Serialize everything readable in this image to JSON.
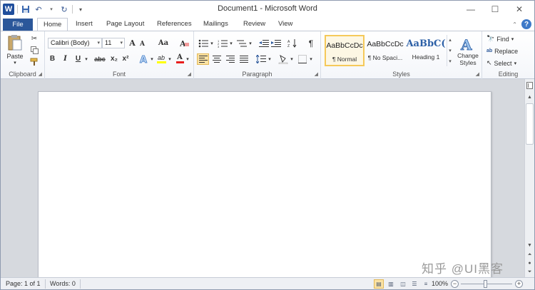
{
  "title_bar": {
    "document_title": "Document1 - Microsoft Word",
    "app_icon": "W",
    "quick_access": [
      "save-icon",
      "undo-icon",
      "redo-icon",
      "customize-icon"
    ],
    "window_controls": {
      "minimize": "—",
      "restore": "☐",
      "close": "✕"
    }
  },
  "tabs": {
    "file": "File",
    "items": [
      "Home",
      "Insert",
      "Page Layout",
      "References",
      "Mailings",
      "Review",
      "View"
    ],
    "active": "Home",
    "help": "?"
  },
  "ribbon": {
    "clipboard": {
      "label": "Clipboard",
      "paste": "Paste"
    },
    "font": {
      "label": "Font",
      "font_name": "Calibri (Body)",
      "font_size": "11",
      "bold": "B",
      "italic": "I",
      "underline": "U",
      "strike": "abc",
      "subscript": "x₂",
      "superscript": "x²",
      "grow": "A",
      "shrink": "A",
      "case": "Aa",
      "clear": "A",
      "highlight": "ab",
      "font_color": "A"
    },
    "paragraph": {
      "label": "Paragraph",
      "pilcrow": "¶"
    },
    "styles": {
      "label": "Styles",
      "items": [
        {
          "preview": "AaBbCcDc",
          "name": "¶ Normal"
        },
        {
          "preview": "AaBbCcDc",
          "name": "¶ No Spaci..."
        },
        {
          "preview": "AaBbC(",
          "name": "Heading 1"
        }
      ],
      "change_styles": [
        "Change",
        "Styles"
      ]
    },
    "editing": {
      "label": "Editing",
      "find": "Find",
      "replace": "Replace",
      "select": "Select"
    }
  },
  "status_bar": {
    "page": "Page: 1 of 1",
    "words": "Words: 0",
    "zoom": "100%",
    "zoom_level_percent": 100
  },
  "watermark": "知乎 @UI黑客",
  "colors": {
    "file_tab": "#2b579a",
    "workspace": "#d6d9de",
    "accent_yellow": "#f5c95a"
  }
}
